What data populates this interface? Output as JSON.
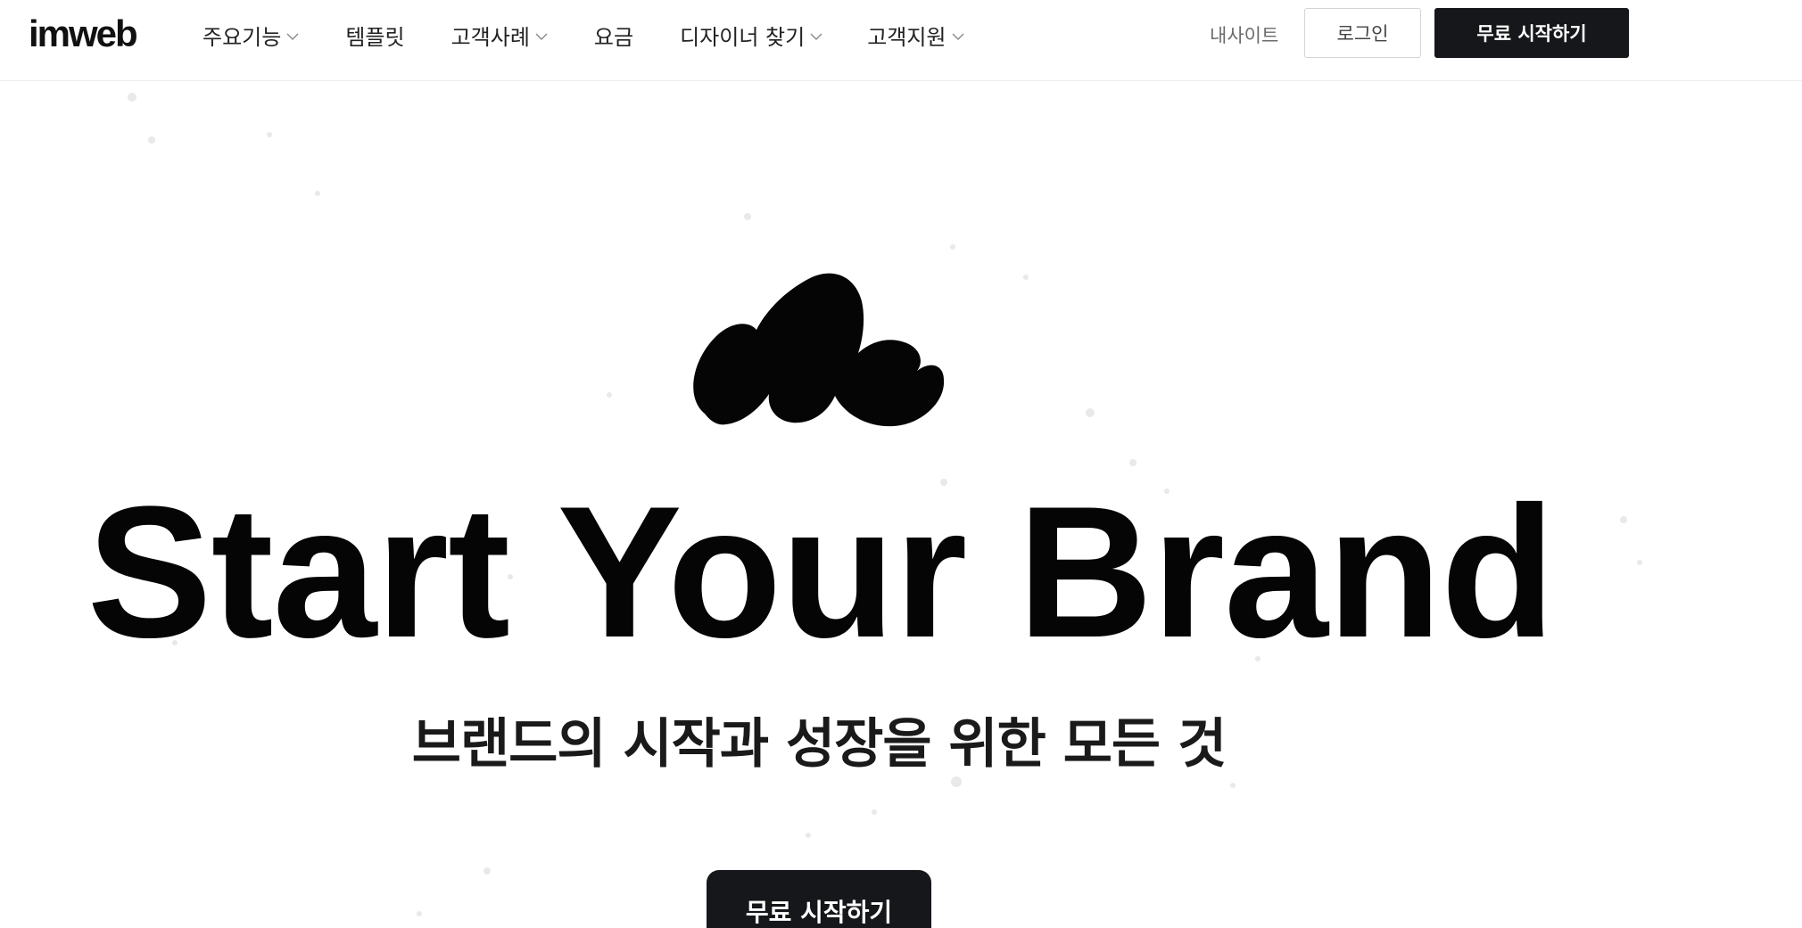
{
  "header": {
    "logo": "imweb",
    "nav": [
      {
        "label": "주요기능",
        "dropdown": true
      },
      {
        "label": "템플릿",
        "dropdown": false
      },
      {
        "label": "고객사례",
        "dropdown": true
      },
      {
        "label": "요금",
        "dropdown": false
      },
      {
        "label": "디자이너 찾기",
        "dropdown": true
      },
      {
        "label": "고객지원",
        "dropdown": true
      }
    ],
    "my_site": "내사이트",
    "login": "로그인",
    "start_free": "무료 시작하기"
  },
  "hero": {
    "title": "Start Your Brand",
    "subtitle": "브랜드의 시작과 성장을 위한 모든 것",
    "cta": "무료 시작하기"
  },
  "colors": {
    "primary_button": "#16171b",
    "text": "#111111",
    "muted": "#6b6b6b",
    "border": "#d5d5d5"
  }
}
